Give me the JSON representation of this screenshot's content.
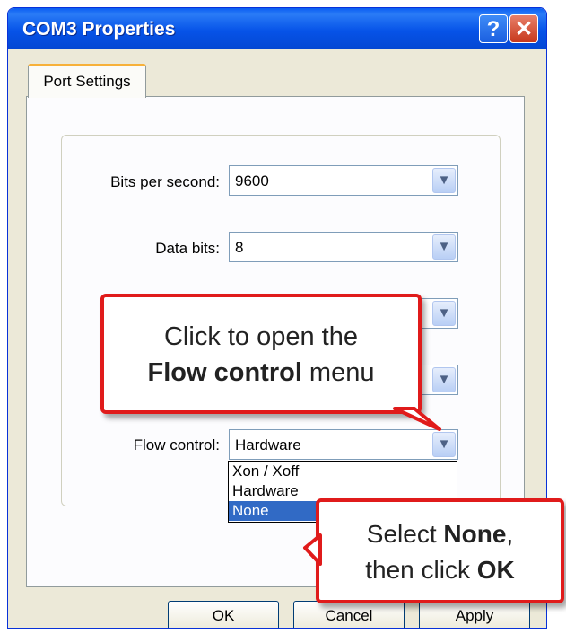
{
  "window": {
    "title": "COM3 Properties",
    "help_glyph": "?",
    "close_glyph": "✕"
  },
  "tabs": [
    {
      "label": "Port Settings"
    }
  ],
  "settings": {
    "bits_per_second": {
      "label": "Bits per second:",
      "value": "9600"
    },
    "data_bits": {
      "label": "Data bits:",
      "value": "8"
    },
    "flow_control": {
      "label": "Flow control:",
      "value": "Hardware",
      "options": [
        "Xon / Xoff",
        "Hardware",
        "None"
      ],
      "highlighted": "None"
    }
  },
  "buttons": {
    "ok": "OK",
    "cancel": "Cancel",
    "apply": "Apply"
  },
  "callouts": {
    "open_menu": {
      "line1": "Click to open the",
      "bold": "Flow control",
      "rest": " menu"
    },
    "select_none": {
      "pre": "Select ",
      "bold1": "None",
      "mid": ",",
      "line2_pre": "then click ",
      "bold2": "OK"
    }
  },
  "colors": {
    "callout_border": "#e01b1b",
    "selection": "#316ac5",
    "titlebar": "#0653e8"
  },
  "icons": {
    "dropdown_arrow": "chevron-down-icon"
  }
}
